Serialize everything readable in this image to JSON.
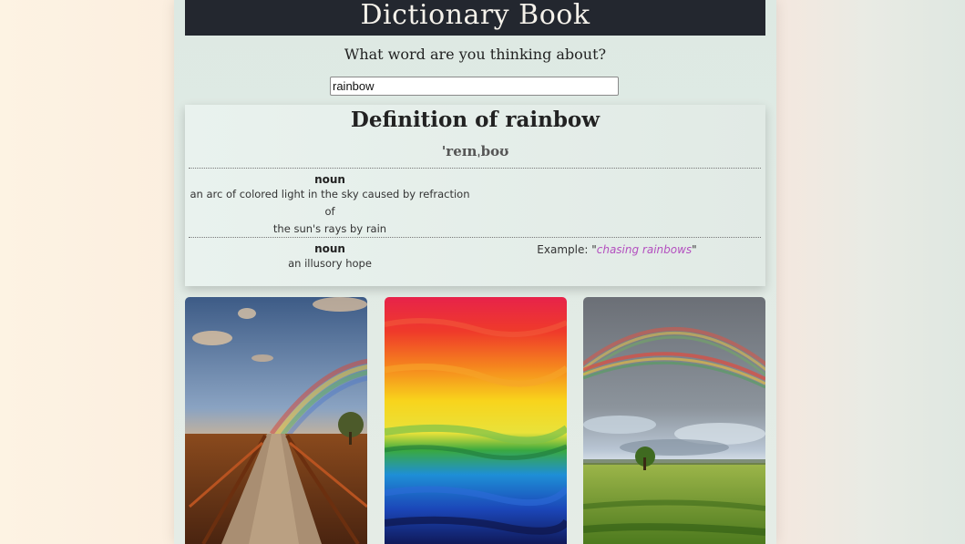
{
  "app": {
    "title": "Dictionary Book",
    "prompt": "What word are you thinking about?"
  },
  "search": {
    "value": "rainbow",
    "placeholder": ""
  },
  "definition": {
    "heading": "Definition of rainbow",
    "phonetic": "'reɪnˌboʊ",
    "meanings": [
      {
        "part_of_speech": "noun",
        "definition_line1": "an arc of colored light in the sky caused by refraction of",
        "definition_line2": "the sun's rays by rain",
        "example": ""
      },
      {
        "part_of_speech": "noun",
        "definition_line1": "an illusory hope",
        "definition_line2": "",
        "example_prefix": "Example: \"",
        "example": "chasing rainbows",
        "example_suffix": "\""
      }
    ]
  },
  "images": [
    {
      "subject": "rainbow over wooden boardwalk at sunset"
    },
    {
      "subject": "rainbow colored abstract paint strokes"
    },
    {
      "subject": "double rainbow over green meadow"
    }
  ],
  "colors": {
    "title_bar": "#23272f",
    "example_accent": "#b34fbf"
  }
}
